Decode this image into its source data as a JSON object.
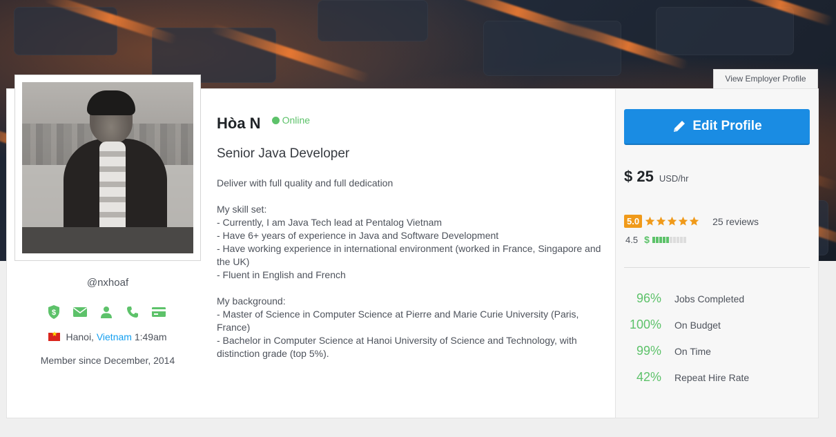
{
  "header": {
    "employer_button": "View Employer Profile"
  },
  "profile": {
    "handle": "@nxhoaf",
    "name": "Hòa N",
    "status": "Online",
    "tagline": "Senior Java Developer",
    "location_city": "Hanoi,",
    "location_country": "Vietnam",
    "local_time": "1:49am",
    "member_since": "Member since December, 2014",
    "verifications": [
      "shield-dollar-icon",
      "mail-icon",
      "user-icon",
      "phone-icon",
      "payment-card-icon"
    ],
    "description": [
      "Deliver with full quality and full dedication",
      "",
      "My skill set:",
      "- Currently, I am Java Tech lead at Pentalog Vietnam",
      "- Have 6+ years of experience in Java and Software Development",
      "- Have working experience in international environment (worked in France, Singapore and the UK)",
      "- Fluent in English and French",
      "",
      "My background:",
      "- Master of Science in Computer Science at Pierre and Marie Curie University (Paris, France)",
      "- Bachelor in Computer Science at Hanoi University of Science and Technology, with distinction grade (top 5%)."
    ]
  },
  "sidebar": {
    "edit_button": "Edit Profile",
    "rate_amount": "$ 25",
    "rate_unit": "USD/hr",
    "rating": "5.0",
    "stars": 5,
    "reviews": "25 reviews",
    "earnings_score": "4.5",
    "earnings_symbol": "$",
    "earnings_level": 5,
    "earnings_max": 10,
    "stats": [
      {
        "pct": "96%",
        "label": "Jobs Completed"
      },
      {
        "pct": "100%",
        "label": "On Budget"
      },
      {
        "pct": "99%",
        "label": "On Time"
      },
      {
        "pct": "42%",
        "label": "Repeat Hire Rate"
      }
    ]
  },
  "colors": {
    "accent": "#1a8ce3",
    "success": "#5dc26a",
    "rating": "#f09a1a",
    "link": "#139ff0"
  }
}
